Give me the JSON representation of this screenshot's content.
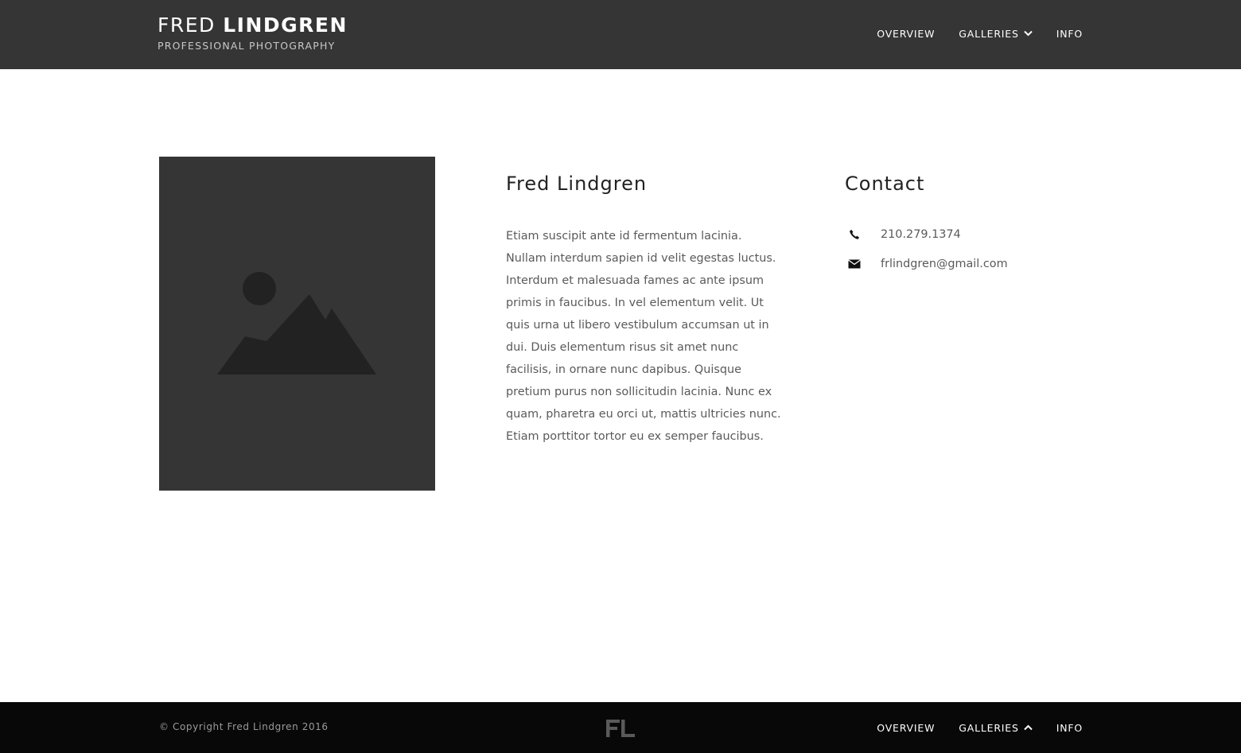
{
  "header": {
    "brand_first": "FRED",
    "brand_last": "LINDGREN",
    "tagline": "PROFESSIONAL PHOTOGRAPHY",
    "nav": [
      {
        "label": "OVERVIEW"
      },
      {
        "label": "GALLERIES",
        "icon": "chevron-down-icon"
      },
      {
        "label": "INFO"
      }
    ]
  },
  "profile": {
    "photo_icon": "image-placeholder-icon",
    "name": "Fred Lindgren",
    "bio": "Etiam suscipit ante id fermentum lacinia. Nullam interdum sapien id velit egestas luctus. Interdum et malesuada fames ac ante ipsum primis in faucibus. In vel elementum velit. Ut quis urna ut libero vestibulum accumsan ut in dui. Duis elementum risus sit amet nunc facilisis, in ornare nunc dapibus. Quisque pretium purus non sollicitudin lacinia. Nunc ex quam, pharetra eu orci ut, mattis ultricies nunc. Etiam porttitor tortor eu ex semper faucibus."
  },
  "contact": {
    "title": "Contact",
    "phone": "210.279.1374",
    "phone_icon": "phone-icon",
    "email": "frlindgren@gmail.com",
    "email_icon": "envelope-icon"
  },
  "footer": {
    "copyright": "© Copyright Fred Lindgren 2016",
    "logo": "FL",
    "nav": [
      {
        "label": "OVERVIEW"
      },
      {
        "label": "GALLERIES",
        "icon": "chevron-up-icon"
      },
      {
        "label": "INFO"
      }
    ]
  },
  "colors": {
    "header_bg": "#353535",
    "footer_bg": "#080808",
    "photo_bg": "#353535",
    "photo_shape": "#222222"
  }
}
